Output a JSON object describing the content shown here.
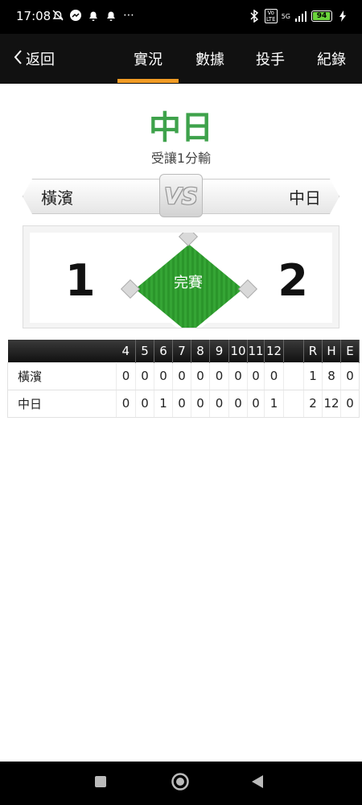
{
  "status_bar": {
    "time": "17:08",
    "battery": "94",
    "network": "5G",
    "volte": "Vo LTE"
  },
  "nav": {
    "back_label": "返回",
    "tabs": [
      "實況",
      "數據",
      "投手",
      "紀錄"
    ],
    "active_tab": 0
  },
  "header": {
    "winner": "中日",
    "result": "受讓1分輸"
  },
  "versus": {
    "away_team": "橫濱",
    "home_team": "中日",
    "badge": "VS"
  },
  "scoreboard": {
    "away_score": "1",
    "home_score": "2",
    "status": "完賽"
  },
  "linescore": {
    "innings": [
      "4",
      "5",
      "6",
      "7",
      "8",
      "9",
      "10",
      "11",
      "12"
    ],
    "totals_headers": [
      "R",
      "H",
      "E"
    ],
    "rows": [
      {
        "team": "橫濱",
        "innings": [
          "0",
          "0",
          "0",
          "0",
          "0",
          "0",
          "0",
          "0",
          "0"
        ],
        "totals": [
          "1",
          "8",
          "0"
        ]
      },
      {
        "team": "中日",
        "innings": [
          "0",
          "0",
          "1",
          "0",
          "0",
          "0",
          "0",
          "0",
          "1"
        ],
        "totals": [
          "2",
          "12",
          "0"
        ]
      }
    ]
  },
  "colors": {
    "accent": "#f19b24",
    "winner_green": "#3ea24b",
    "field_green": "#2e9a2e",
    "nav_bg": "#111111"
  }
}
